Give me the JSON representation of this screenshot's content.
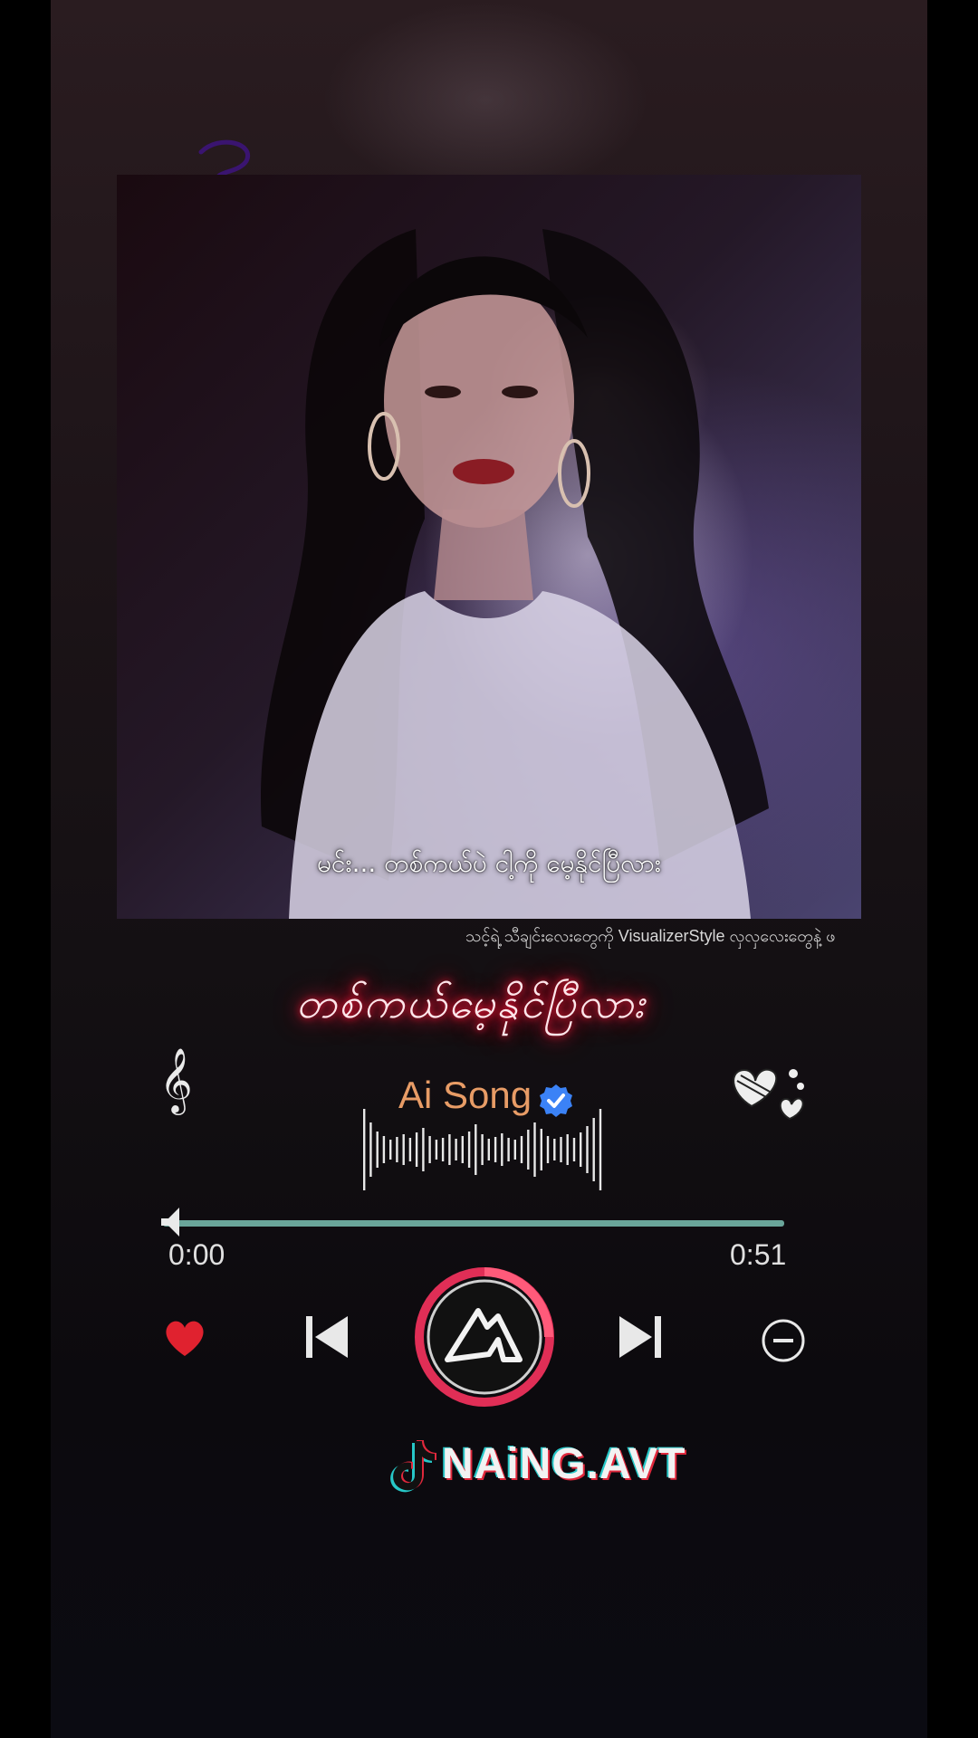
{
  "player": {
    "subtitle": "မင်း... တစ်ကယ်ပဲ ငါ့ကို မေ့နိုင်ပြီလား",
    "marquee": "သင့်ရဲ့ သီချင်းလေးတွေကို VisualizerStyle လှလှလေးတွေနဲ့ ဖ",
    "song_title": "တစ်ကယ်မေ့နိုင်ပြီလား",
    "artist": "Ai Song",
    "time_current": "0:00",
    "time_total": "0:51",
    "progress": 0.0,
    "credit_handle": "NAiNG.AVT"
  },
  "icons": {
    "clef": "𝄞",
    "left_decor": "treble-clef-icon",
    "right_decor": "hearts-doodle-icon",
    "verified": "verified-badge-icon",
    "like": "heart-icon",
    "prev": "skip-previous-icon",
    "play": "play-logo-icon",
    "next": "skip-next-icon",
    "remove": "minus-circle-icon",
    "tiktok": "tiktok-icon"
  },
  "colors": {
    "neon_red": "#ff1a3c",
    "artist": "#e89c66",
    "progress": "#6aa59a",
    "heart": "#e0222f",
    "verified": "#3b82f6"
  }
}
